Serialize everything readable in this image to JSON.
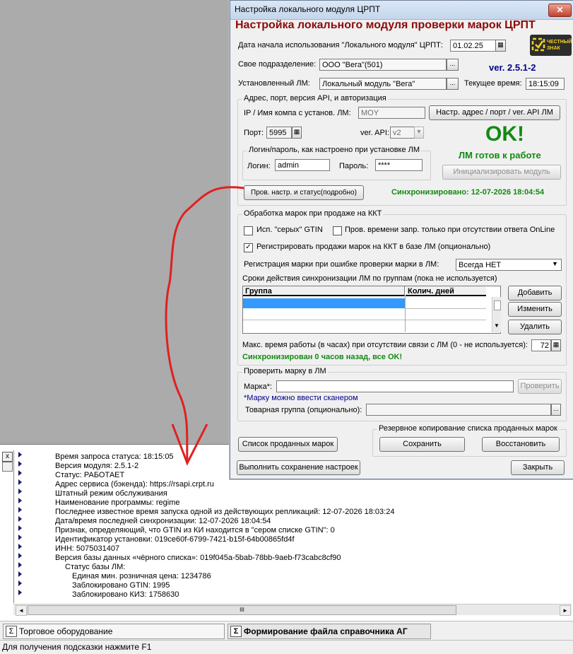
{
  "dialog": {
    "window_title": "Настройка локального модуля ЦРПТ",
    "close_glyph": "✕",
    "main_title": "Настройка локального модуля проверки марок ЦРПТ",
    "logo_text": "ЧЕСТНЫЙ ЗНАК",
    "start_date_label": "Дата начала использования \"Локального модуля\" ЦРПТ:",
    "start_date_value": "01.02.25",
    "version": "ver. 2.5.1-2",
    "own_division_label": "Свое подразделение:",
    "own_division_value": "ООО \"Вега\"(501)",
    "installed_lm_label": "Установленный ЛМ:",
    "installed_lm_value": "Локальный модуль \"Вега\"",
    "current_time_label": "Текущее время:",
    "current_time_value": "18:15:09",
    "ellipsis": "...",
    "address_group": {
      "title": "Адрес, порт,  версия API,  и авторизация",
      "ip_label": "IP / Имя компа с установ. ЛМ:",
      "ip_value": "MOY",
      "set_address_button": "Настр. адрес / порт / ver. API ЛМ",
      "port_label": "Порт:",
      "port_value": "5995",
      "api_label": "ver. API:",
      "api_value": "v2",
      "ok_big": "OK!",
      "ready_text": "ЛМ готов к работе",
      "login_group_title": "Логин/пароль, как настроено при установке ЛМ",
      "login_label": "Логин:",
      "login_value": "admin",
      "password_label": "Пароль:",
      "password_value": "****",
      "init_button": "Инициализировать модуль",
      "check_settings_button": "Пров. настр. и статус(подробно)",
      "synced_text": "Синхронизировано: 12-07-2026 18:04:54"
    },
    "processing_group": {
      "title": "Обработка марок при продаже на ККТ",
      "gray_gtin_label": "Исп. \"серых\" GTIN",
      "gray_gtin_checked": false,
      "time_check_label": "Пров. времени запр. только при отсутствии ответа OnLine",
      "time_check_checked": false,
      "register_label": "Регистрировать продажи марок на ККТ в базе ЛМ (опционально)",
      "register_checked": true,
      "error_reg_label": "Регистрация марки при ошибке проверки марки в ЛМ:",
      "error_reg_value": "Всегда НЕТ",
      "sync_terms_label": "Сроки действия синхронизации ЛМ по группам (пока не используется)",
      "table_headers": [
        "Группа",
        "Колич. дней"
      ],
      "add_button": "Добавить",
      "edit_button": "Изменить",
      "delete_button": "Удалить",
      "max_time_label": "Макс. время работы (в часах) при отсутствии связи с ЛМ (0 - не используется):",
      "max_time_value": "72",
      "sync_status": "Синхронизирован 0 часов назад, все OK!"
    },
    "check_group": {
      "title": "Проверить марку в ЛМ",
      "mark_label": "Марка*:",
      "check_button": "Проверить",
      "scanner_hint": "*Марку можно ввести сканером",
      "product_group_label": "Товарная группа (опционально):"
    },
    "backup_group": {
      "title": "Резервное копирование списка проданных марок",
      "save_button": "Сохранить",
      "restore_button": "Восстановить"
    },
    "sold_list_button": "Список проданных марок",
    "save_settings_button": "Выполнить сохранение настроек",
    "close_button": "Закрыть"
  },
  "log": {
    "close_glyph": "x",
    "lines": [
      "Время запроса статуса: 18:15:05",
      "Версия модуля: 2.5.1-2",
      "Статус: РАБОТАЕТ",
      "Адрес сервиса (бэкенда): https://rsapi.crpt.ru",
      "Штатный режим обслуживания",
      "Наименование программы: regime",
      "Последнее известное время запуска одной из действующих репликаций: 12-07-2026 18:03:24",
      "Дата/время последней синхронизации: 12-07-2026 18:04:54",
      "Признак, определяющий, что GTIN из КИ находится в \"сером списке GTIN\": 0",
      "Идентификатор установки: 019ce60f-6799-7421-b15f-64b00865fd4f",
      "ИНН: 5075031407",
      "Версия базы данных «чёрного списка»: 019f045a-5bab-78bb-9aeb-f73cabc8cf90",
      "Статус базы ЛМ:",
      "Единая мин. розничная цена: 1234786",
      "Заблокировано GTIN: 1995",
      "Заблокировано КИЗ: 1758630"
    ],
    "scroll_thumb_text": "III",
    "scroll_left": "◄",
    "scroll_right": "►"
  },
  "taskbar": {
    "sigma": "Σ",
    "item1": "Торговое оборудование",
    "item2": "Формирование файла справочника АГ"
  },
  "statusbar": "Для получения подсказки нажмите F1",
  "colors": {
    "title_red": "#8b0a0a",
    "ok_green": "#128a12",
    "version_blue": "#00008b",
    "annotation_red": "#e02020"
  }
}
